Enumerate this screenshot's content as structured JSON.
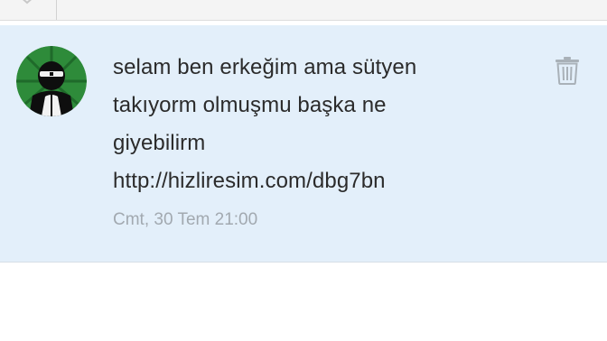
{
  "message": {
    "lines": [
      "selam ben erkeğim ama sütyen",
      "takıyorm olmuşmu başka ne",
      "giyebilirm",
      "http://hizliresim.com/dbg7bn"
    ],
    "timestamp": "Cmt, 30 Tem 21:00"
  },
  "icons": {
    "top_bar": "chevron-down-icon",
    "delete": "trash-icon",
    "avatar": "user-avatar-icon"
  },
  "colors": {
    "card_background": "#e3effa",
    "message_text": "#2b2b2b",
    "timestamp_text": "#a2a9b0",
    "avatar_green": "#2e8b3a",
    "trash_icon": "#a9b1b8"
  }
}
